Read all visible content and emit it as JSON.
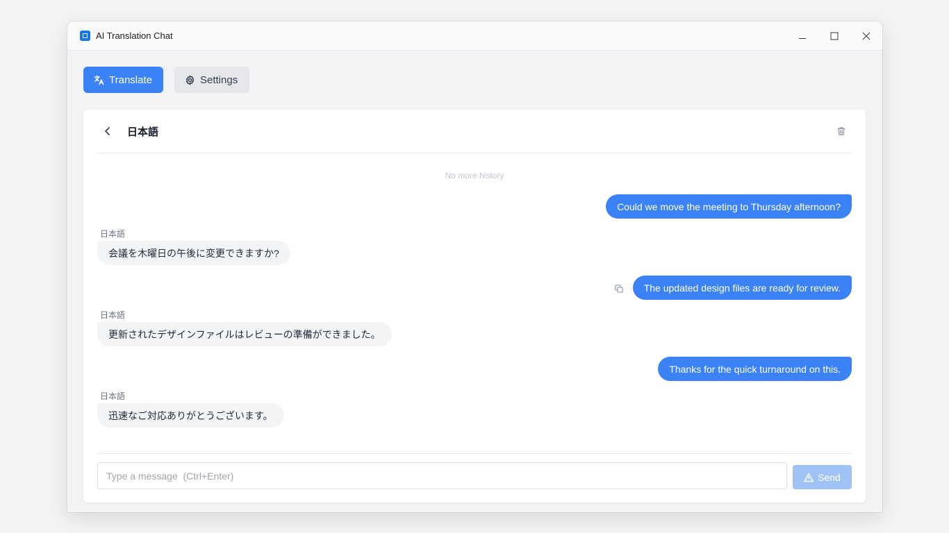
{
  "window": {
    "title": "AI Translation Chat",
    "controls": [
      "minimize-icon",
      "maximize-icon",
      "close-icon"
    ]
  },
  "tabs": [
    {
      "label": "Translate",
      "icon": "translate-icon",
      "active": true
    },
    {
      "label": "Settings",
      "icon": "gear-icon",
      "active": false
    }
  ],
  "chat": {
    "language": "日本語",
    "history_note": "No more history",
    "messages": [
      {
        "role": "user",
        "text": "Could we move the meeting to Thursday afternoon?"
      },
      {
        "role": "assistant",
        "sender": "日本語",
        "text": "会議を木曜日の午後に変更できますか?"
      },
      {
        "role": "user",
        "text": "The updated design files are ready for review."
      },
      {
        "role": "assistant",
        "sender": "日本語",
        "text": "更新されたデザインファイルはレビューの準備ができました。"
      },
      {
        "role": "user",
        "text": "Thanks for the quick turnaround on this."
      },
      {
        "role": "assistant",
        "sender": "日本語",
        "text": "迅速なご対応ありがとうございます。"
      }
    ]
  },
  "composer": {
    "placeholder": "Type a message  (Ctrl+Enter)",
    "value": "",
    "send_label": "Send",
    "send_enabled": false
  },
  "colors": {
    "accent": "#3b82f6",
    "send_disabled": "#a0c3f7",
    "bot_bubble": "#f3f4f6"
  }
}
